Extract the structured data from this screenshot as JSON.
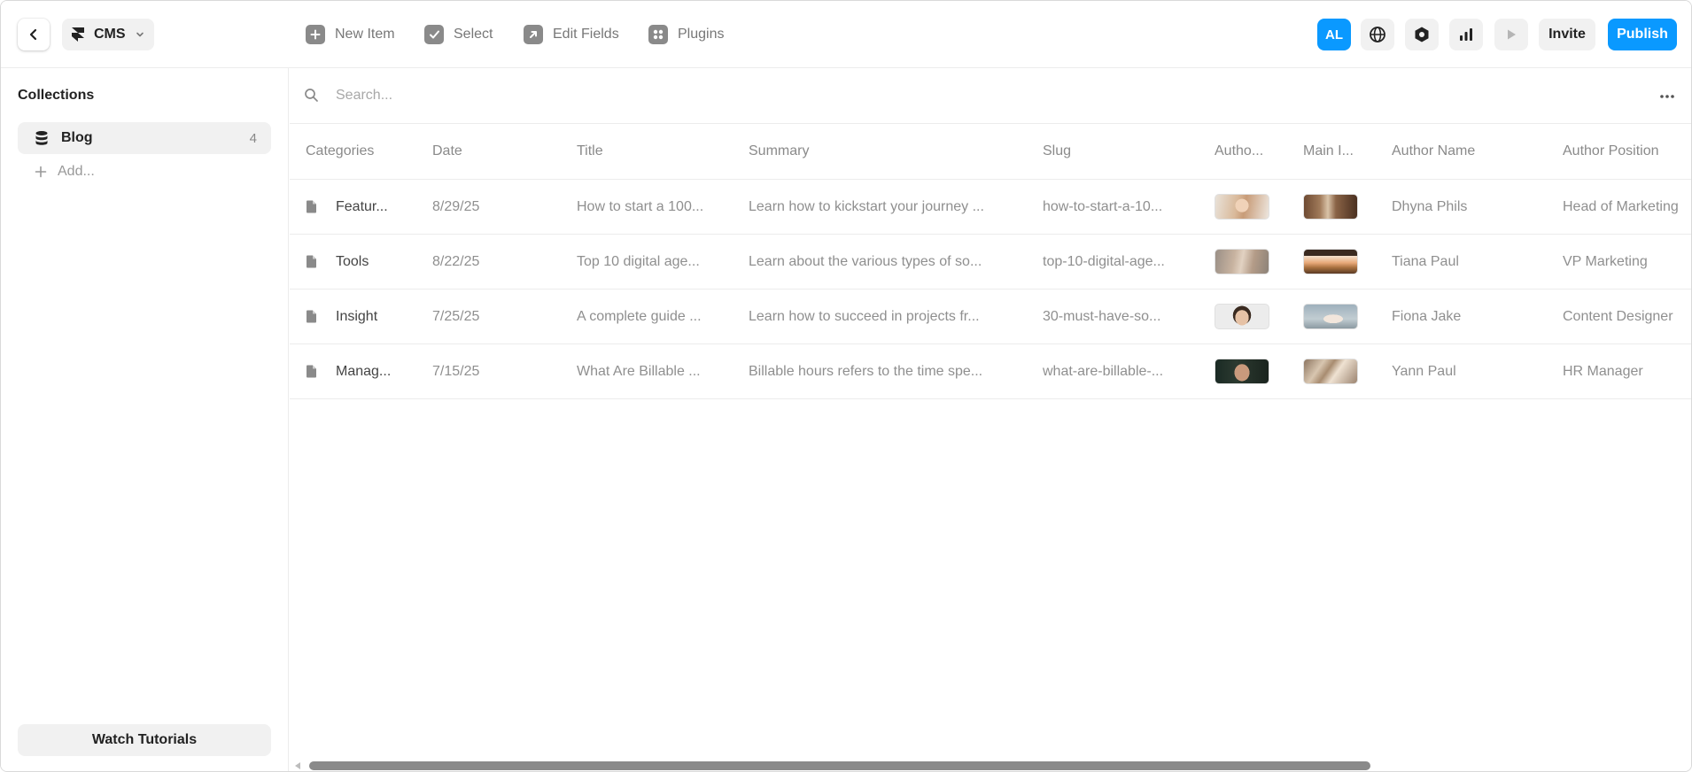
{
  "topbar": {
    "project_label": "CMS",
    "tools": [
      {
        "label": "New Item",
        "icon": "plus-square-icon"
      },
      {
        "label": "Select",
        "icon": "check-square-icon"
      },
      {
        "label": "Edit Fields",
        "icon": "arrow-up-right-square-icon"
      },
      {
        "label": "Plugins",
        "icon": "plugins-grid-icon"
      }
    ],
    "avatar_initials": "AL",
    "invite_label": "Invite",
    "publish_label": "Publish"
  },
  "sidebar": {
    "title": "Collections",
    "collection": {
      "label": "Blog",
      "count": "4"
    },
    "add_label": "Add...",
    "tutorials_label": "Watch Tutorials"
  },
  "search": {
    "placeholder": "Search..."
  },
  "table": {
    "columns": [
      "Categories",
      "Date",
      "Title",
      "Summary",
      "Slug",
      "Autho...",
      "Main I...",
      "Author Name",
      "Author Position"
    ],
    "rows": [
      {
        "category": "Featur...",
        "date": "8/29/25",
        "title": "How to start a 100...",
        "summary": "Learn how to kickstart your journey ...",
        "slug": "how-to-start-a-10...",
        "author_name": "Dhyna Phils",
        "author_position": "Head of Marketing"
      },
      {
        "category": "Tools",
        "date": "8/22/25",
        "title": "Top 10 digital age...",
        "summary": "Learn about the various types of so...",
        "slug": "top-10-digital-age...",
        "author_name": "Tiana Paul",
        "author_position": "VP Marketing"
      },
      {
        "category": "Insight",
        "date": "7/25/25",
        "title": "A complete guide ...",
        "summary": "Learn how to succeed in projects fr...",
        "slug": "30-must-have-so...",
        "author_name": "Fiona Jake",
        "author_position": "Content Designer"
      },
      {
        "category": "Manag...",
        "date": "7/15/25",
        "title": "What Are Billable ...",
        "summary": "Billable hours refers to the time spe...",
        "slug": "what-are-billable-...",
        "author_name": "Yann Paul",
        "author_position": "HR Manager"
      }
    ]
  },
  "colors": {
    "accent": "#0a99ff",
    "muted_text": "#8f8f8f",
    "surface": "#f1f1f1"
  }
}
